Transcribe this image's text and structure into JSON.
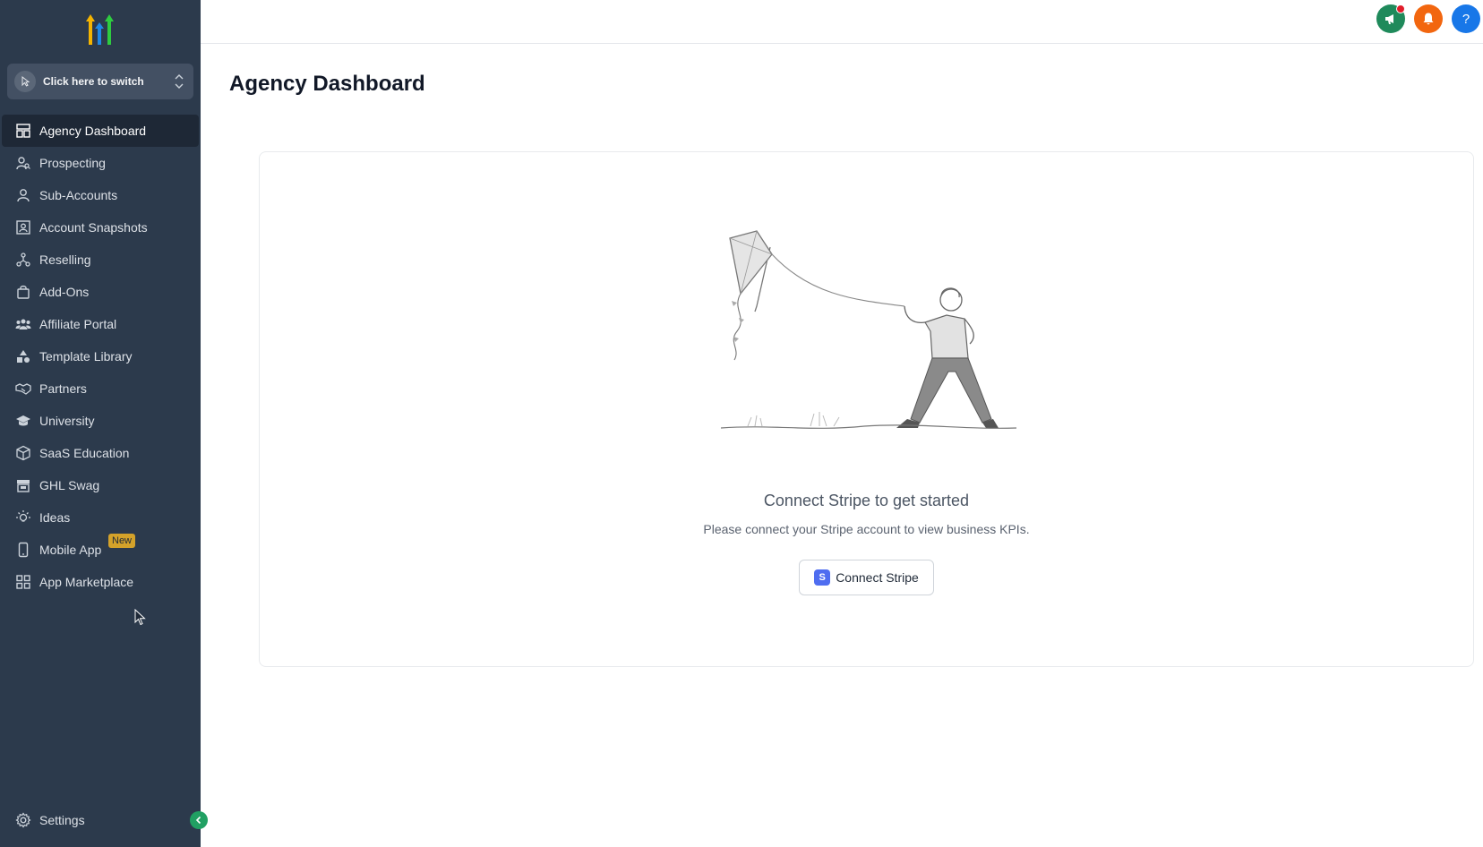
{
  "sidebar": {
    "switcher": {
      "label": "Click here to switch"
    },
    "items": [
      {
        "label": "Agency Dashboard",
        "icon": "dashboard-icon"
      },
      {
        "label": "Prospecting",
        "icon": "prospecting-icon"
      },
      {
        "label": "Sub-Accounts",
        "icon": "user-icon"
      },
      {
        "label": "Account Snapshots",
        "icon": "snapshot-icon"
      },
      {
        "label": "Reselling",
        "icon": "reselling-icon"
      },
      {
        "label": "Add-Ons",
        "icon": "bag-icon"
      },
      {
        "label": "Affiliate Portal",
        "icon": "group-icon"
      },
      {
        "label": "Template Library",
        "icon": "shapes-icon"
      },
      {
        "label": "Partners",
        "icon": "handshake-icon"
      },
      {
        "label": "University",
        "icon": "graduation-cap-icon"
      },
      {
        "label": "SaaS Education",
        "icon": "box-icon"
      },
      {
        "label": "GHL Swag",
        "icon": "store-icon"
      },
      {
        "label": "Ideas",
        "icon": "lightbulb-icon"
      },
      {
        "label": "Mobile App",
        "icon": "phone-icon",
        "badge": "New"
      },
      {
        "label": "App Marketplace",
        "icon": "grid-icon"
      }
    ],
    "settings": {
      "label": "Settings"
    }
  },
  "header": {
    "help_label": "?"
  },
  "main": {
    "title": "Agency Dashboard",
    "empty_state": {
      "title": "Connect Stripe to get started",
      "subtitle": "Please connect your Stripe account to view business KPIs.",
      "button_label": "Connect Stripe",
      "button_icon_letter": "S"
    }
  },
  "colors": {
    "sidebar_bg": "#2c3a4c",
    "announce": "#1f8a5b",
    "notify": "#f2660f",
    "help": "#1877e8",
    "badge": "#d4a22a",
    "collapse": "#21a063"
  }
}
